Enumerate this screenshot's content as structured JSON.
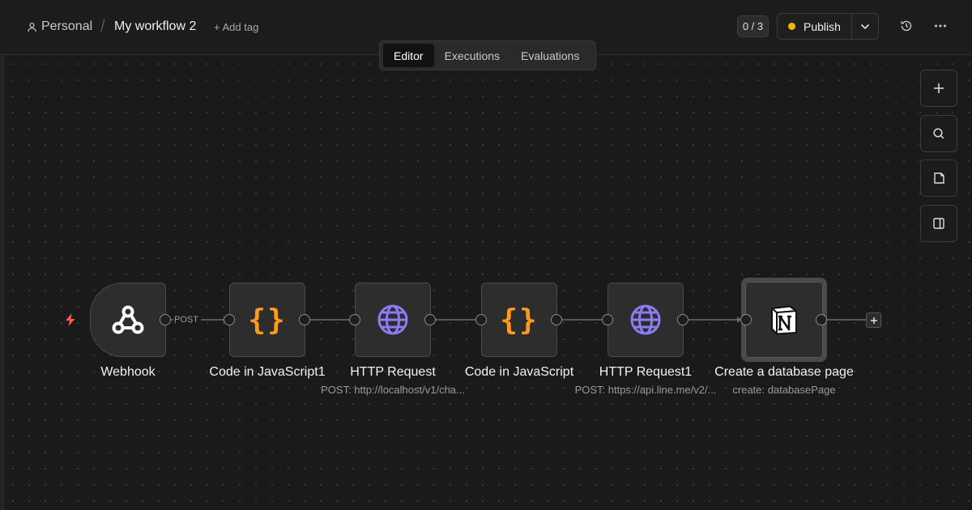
{
  "header": {
    "project": "Personal",
    "separator": "/",
    "workflow_name": "My workflow 2",
    "add_tag": "+ Add tag",
    "counter": "0 / 3",
    "publish_label": "Publish",
    "publish_dot_color": "#f5b800"
  },
  "tabs": [
    {
      "label": "Editor",
      "active": true
    },
    {
      "label": "Executions",
      "active": false
    },
    {
      "label": "Evaluations",
      "active": false
    }
  ],
  "side_buttons": [
    "plus-icon",
    "search-icon",
    "sticky-note-icon",
    "panel-icon"
  ],
  "nodes": [
    {
      "label": "Webhook",
      "sublabel": "",
      "icon": "webhook-icon"
    },
    {
      "label": "Code in JavaScript1",
      "sublabel": "",
      "icon": "code-braces-icon"
    },
    {
      "label": "HTTP Request",
      "sublabel": "POST: http://localhost/v1/cha...",
      "icon": "globe-icon"
    },
    {
      "label": "Code in JavaScript",
      "sublabel": "",
      "icon": "code-braces-icon"
    },
    {
      "label": "HTTP Request1",
      "sublabel": "POST: https://api.line.me/v2/...",
      "icon": "globe-icon"
    },
    {
      "label": "Create a database page",
      "sublabel": "create: databasePage",
      "icon": "notion-icon"
    }
  ],
  "connection_label": "POST",
  "colors": {
    "code_icon": "#ff9a1f",
    "globe_icon": "#8b7cf6",
    "trigger_bolt": "#ff5c4d"
  }
}
